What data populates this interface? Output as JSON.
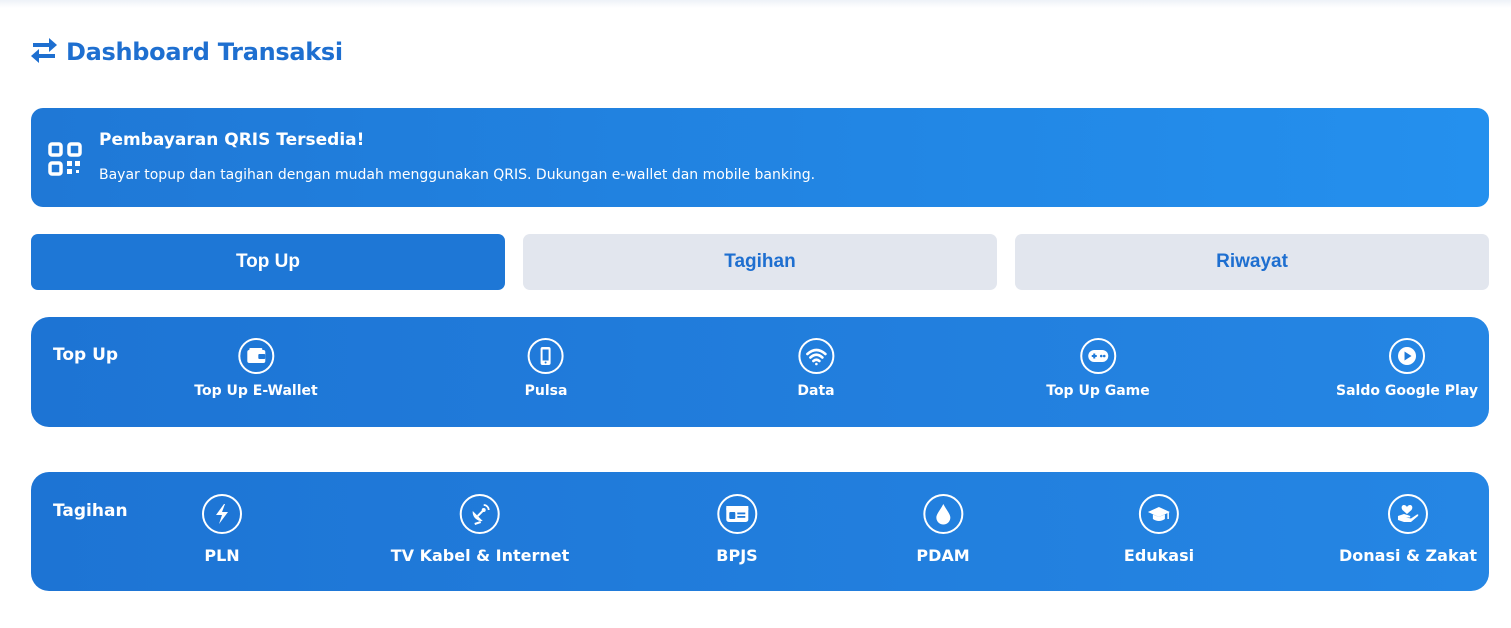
{
  "header": {
    "title": "Dashboard Transaksi",
    "icon": "arrows-exchange-icon",
    "color": "#1e6fd0"
  },
  "banner": {
    "icon": "qr-code-icon",
    "title": "Pembayaran QRIS Tersedia!",
    "description": "Bayar topup dan tagihan dengan mudah menggunakan QRIS. Dukungan e-wallet dan mobile banking."
  },
  "tabs": [
    {
      "label": "Top Up",
      "active": true
    },
    {
      "label": "Tagihan",
      "active": false
    },
    {
      "label": "Riwayat",
      "active": false
    }
  ],
  "topup": {
    "label": "Top Up",
    "items": [
      {
        "label": "Top Up E-Wallet",
        "icon": "wallet-icon"
      },
      {
        "label": "Pulsa",
        "icon": "mobile-phone-icon"
      },
      {
        "label": "Data",
        "icon": "wifi-icon"
      },
      {
        "label": "Top Up Game",
        "icon": "gamepad-icon"
      },
      {
        "label": "Saldo Google Play",
        "icon": "play-icon"
      }
    ]
  },
  "tagihan": {
    "label": "Tagihan",
    "items": [
      {
        "label": "PLN",
        "icon": "lightning-icon"
      },
      {
        "label": "TV Kabel & Internet",
        "icon": "satellite-dish-icon"
      },
      {
        "label": "BPJS",
        "icon": "id-card-icon"
      },
      {
        "label": "PDAM",
        "icon": "water-drop-icon"
      },
      {
        "label": "Edukasi",
        "icon": "graduation-cap-icon"
      },
      {
        "label": "Donasi & Zakat",
        "icon": "hand-holding-heart-icon"
      }
    ]
  },
  "colors": {
    "primary": "#1e77d6",
    "banner_end": "#2490ee",
    "tab_inactive_bg": "#e2e6ee"
  }
}
